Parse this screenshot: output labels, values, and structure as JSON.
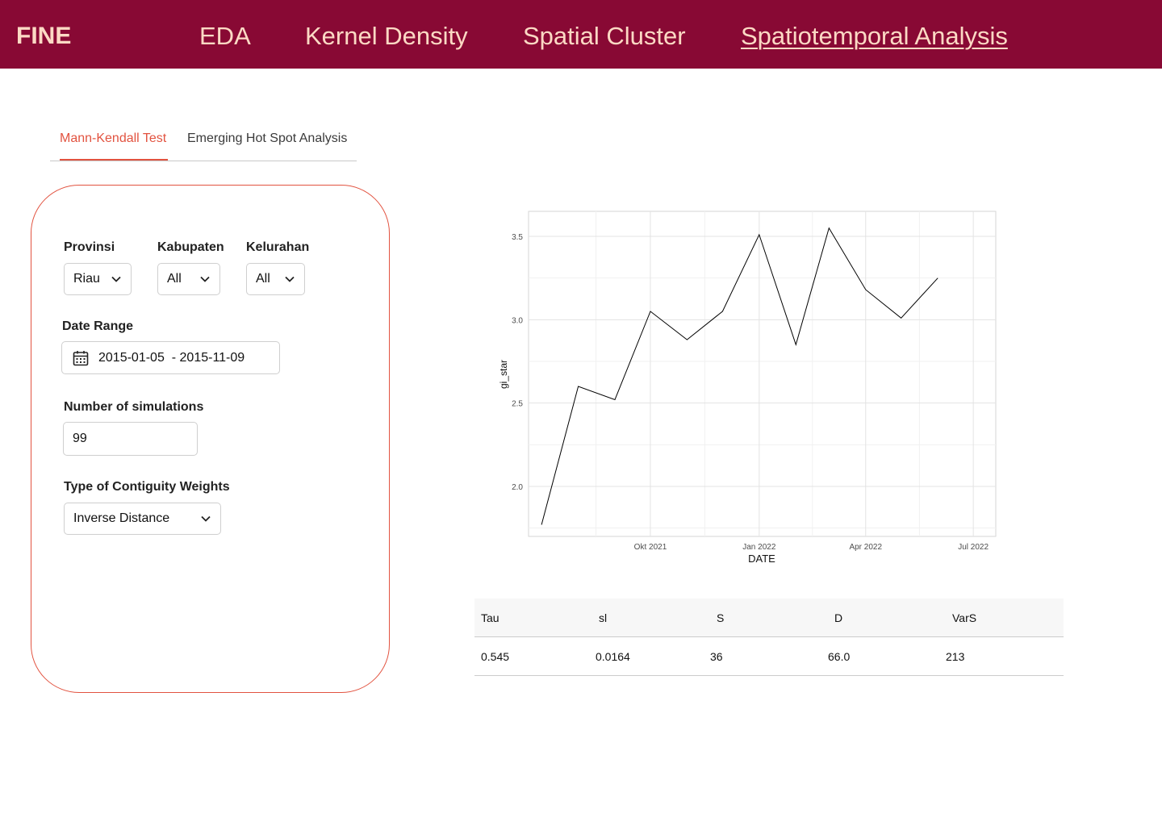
{
  "nav": {
    "brand": "FINE",
    "items": [
      "EDA",
      "Kernel Density",
      "Spatial Cluster",
      "Spatiotemporal Analysis"
    ],
    "active_index": 3
  },
  "tabs": {
    "items": [
      "Mann-Kendall Test",
      "Emerging Hot Spot Analysis"
    ],
    "active_index": 0
  },
  "filters": {
    "provinsi": {
      "label": "Provinsi",
      "value": "Riau"
    },
    "kabupaten": {
      "label": "Kabupaten",
      "value": "All"
    },
    "kelurahan": {
      "label": "Kelurahan",
      "value": "All"
    },
    "date_range": {
      "label": "Date Range",
      "start": "2015-01-05",
      "separator": "-",
      "end": "2015-11-09"
    },
    "simulations": {
      "label": "Number of simulations",
      "value": "99"
    },
    "contiguity": {
      "label": "Type of Contiguity Weights",
      "value": "Inverse Distance"
    }
  },
  "chart_data": {
    "type": "line",
    "xlabel": "DATE",
    "ylabel": "gi_star",
    "x": [
      "2021-07-01",
      "2021-08-01",
      "2021-09-01",
      "2021-10-01",
      "2021-11-01",
      "2021-12-01",
      "2022-01-01",
      "2022-02-01",
      "2022-03-01",
      "2022-04-01",
      "2022-05-01",
      "2022-06-01",
      "2022-07-01"
    ],
    "values": [
      1.77,
      2.6,
      2.52,
      3.05,
      2.88,
      3.05,
      3.51,
      2.85,
      3.55,
      3.18,
      3.01,
      3.25
    ],
    "x_dates": [
      "2021-07-01",
      "2021-08-01",
      "2021-09-01",
      "2021-10-01",
      "2021-11-01",
      "2021-12-01",
      "2022-01-01",
      "2022-02-01",
      "2022-03-01",
      "2022-04-01",
      "2022-05-01",
      "2022-06-01"
    ],
    "xticks": [
      {
        "date": "2021-10-01",
        "label": "Okt 2021"
      },
      {
        "date": "2022-01-01",
        "label": "Jan 2022"
      },
      {
        "date": "2022-04-01",
        "label": "Apr 2022"
      },
      {
        "date": "2022-07-01",
        "label": "Jul 2022"
      }
    ],
    "yticks": [
      2.0,
      2.5,
      3.0,
      3.5
    ],
    "xlim": [
      "2021-06-20",
      "2022-07-20"
    ],
    "ylim": [
      1.7,
      3.65
    ],
    "grid": true,
    "line_color": "#000000"
  },
  "results": {
    "headers": [
      "Tau",
      "sl",
      "S",
      "D",
      "VarS"
    ],
    "rows": [
      [
        "0.545",
        "0.0164",
        "36",
        "66.0",
        "213"
      ]
    ]
  },
  "colors": {
    "nav_bg": "#880934",
    "nav_text": "#fcd9c4",
    "accent": "#e25340"
  }
}
